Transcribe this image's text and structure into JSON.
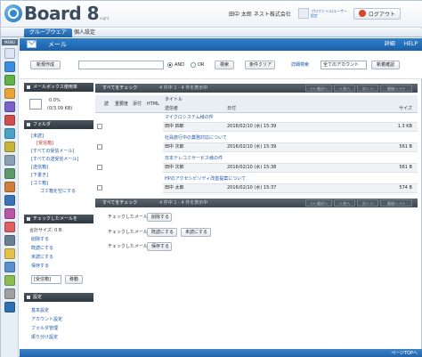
{
  "header": {
    "logo_text": "Board 8",
    "logo_sub": "eight",
    "user_name": "田中 太郎  ネスト株式会社",
    "user_link": "プロファイル/ユーザー設定",
    "logout_label": "ログアウト"
  },
  "tabs": [
    {
      "label": "グループウェア"
    },
    {
      "label": "個人設定"
    }
  ],
  "iconbar": {
    "menu_label": "MENU"
  },
  "title": {
    "text": "メール",
    "link_setting": "詳細",
    "link_help": "HELP"
  },
  "search": {
    "new_button": "新規作成",
    "query_value": "",
    "and_label": "AND",
    "or_label": "OR",
    "search_button": "検索",
    "clear_button": "条件クリア",
    "advanced_label": "詳細検索",
    "account_select": "全てのアカウント",
    "check_new_button": "新着確認"
  },
  "mailbox": {
    "head": "メールボックス使用率",
    "percent": "0.0%",
    "usage": "(0/3.09 KB)"
  },
  "folders": {
    "head": "フォルダ",
    "items": [
      "[未読]",
      "[受信箱]",
      "[すべての受信メール]",
      "[すべての送受信メール]",
      "[送信箱]",
      "[下書き]",
      "[ゴミ箱]",
      "ゴミ箱を空にする"
    ]
  },
  "checked": {
    "head": "チェックしたメールを",
    "total_size": "合計サイズ: 0 B",
    "actions": [
      "削除する",
      "既読にする",
      "未読にする",
      "保存する"
    ],
    "move_select": "[受信箱]",
    "move_button": "移動"
  },
  "settings": {
    "head": "設定",
    "items": [
      "基本設定",
      "アカウント設定",
      "フォルダ管理",
      "振り分け設定"
    ]
  },
  "list": {
    "check_all": "すべてをチェック",
    "range": "4 件中 1 - 4 件を表示中",
    "pager": [
      "<< 最初へ",
      "< 前へ",
      "次へ >",
      "最後へ >>"
    ],
    "headers": {
      "read": "読",
      "importance": "重要度",
      "attach": "添付",
      "html": "HTML",
      "title": "タイトル",
      "sender": "送信者",
      "date": "日付",
      "size": "サイズ"
    },
    "rows": [
      {
        "subject": "マイクロシステム様の件",
        "sender": "田中 四郎",
        "date": "2016/02/10 (水) 15:39",
        "size": "1.3 KB"
      },
      {
        "subject": "社員旅行中の業務対応について",
        "sender": "田中 次郎",
        "date": "2016/02/10 (水) 15:39",
        "size": "561 B"
      },
      {
        "subject": "日本テレコミサービス様の件",
        "sender": "田中 次郎",
        "date": "2016/02/10 (水) 15:38",
        "size": "561 B"
      },
      {
        "subject": "HPのアクセシビリティ改善提案について",
        "sender": "田中 太郎",
        "date": "2016/02/10 (水) 15:37",
        "size": "574 B"
      }
    ]
  },
  "bottom_actions": {
    "label": "チェックしたメールを",
    "delete": "削除する",
    "mark_read": "既読にする",
    "mark_unread": "未読にする",
    "save": "保存する"
  },
  "footer": {
    "top_link": "ページTOPへ"
  }
}
